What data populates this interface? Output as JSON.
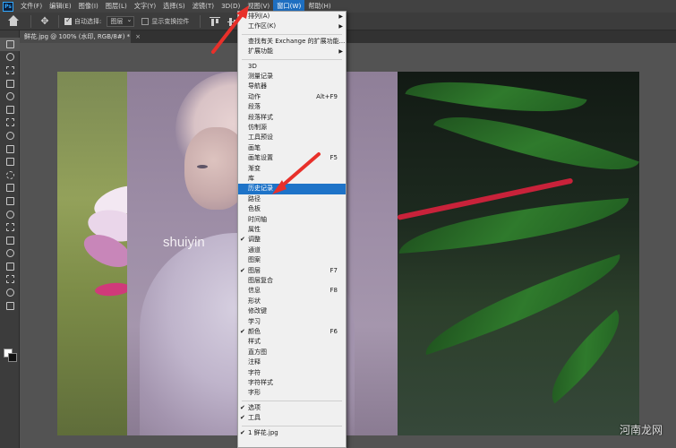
{
  "menubar": {
    "items": [
      "文件(F)",
      "编辑(E)",
      "图像(I)",
      "图层(L)",
      "文字(Y)",
      "选择(S)",
      "滤镜(T)",
      "3D(D)",
      "视图(V)",
      "窗口(W)",
      "帮助(H)"
    ],
    "active_index": 9
  },
  "optbar": {
    "auto_select_label": "自动选择:",
    "auto_select_value": "图层",
    "show_transform_label": "显示变换控件"
  },
  "document": {
    "tab_title": "鲜花.jpg @ 100% (水印, RGB/8#) *",
    "close": "×",
    "watermark_text": "shuiyin"
  },
  "window_menu": {
    "items": [
      {
        "label": "排列(A)",
        "submenu": true
      },
      {
        "label": "工作区(K)",
        "submenu": true
      },
      {
        "separator": true
      },
      {
        "label": "查找有关 Exchange 的扩展功能..."
      },
      {
        "label": "扩展功能",
        "submenu": true
      },
      {
        "separator": true
      },
      {
        "label": "3D"
      },
      {
        "label": "测量记录"
      },
      {
        "label": "导航器"
      },
      {
        "label": "动作",
        "shortcut": "Alt+F9"
      },
      {
        "label": "段落"
      },
      {
        "label": "段落样式"
      },
      {
        "label": "仿制源"
      },
      {
        "label": "工具预设"
      },
      {
        "label": "画笔"
      },
      {
        "label": "画笔设置",
        "shortcut": "F5"
      },
      {
        "label": "渐变"
      },
      {
        "label": "库"
      },
      {
        "label": "历史记录",
        "highlighted": true
      },
      {
        "label": "路径"
      },
      {
        "label": "色板"
      },
      {
        "label": "时间轴"
      },
      {
        "label": "属性"
      },
      {
        "label": "调整",
        "checked": true
      },
      {
        "label": "通道"
      },
      {
        "label": "图案"
      },
      {
        "label": "图层",
        "checked": true,
        "shortcut": "F7"
      },
      {
        "label": "图层复合"
      },
      {
        "label": "信息",
        "shortcut": "F8"
      },
      {
        "label": "形状"
      },
      {
        "label": "修改键"
      },
      {
        "label": "学习"
      },
      {
        "label": "颜色",
        "checked": true,
        "shortcut": "F6"
      },
      {
        "label": "样式"
      },
      {
        "label": "直方图"
      },
      {
        "label": "注释"
      },
      {
        "label": "字符"
      },
      {
        "label": "字符样式"
      },
      {
        "label": "字形"
      },
      {
        "separator": true
      },
      {
        "label": "选项",
        "checked": true
      },
      {
        "label": "工具",
        "checked": true
      },
      {
        "separator": true
      },
      {
        "label": "1 鲜花.jpg",
        "checked": true
      }
    ]
  },
  "brand_text": "河南龙网",
  "colors": {
    "highlight": "#1e73c8",
    "arrow": "#e8302a",
    "menubar": "#424242"
  }
}
